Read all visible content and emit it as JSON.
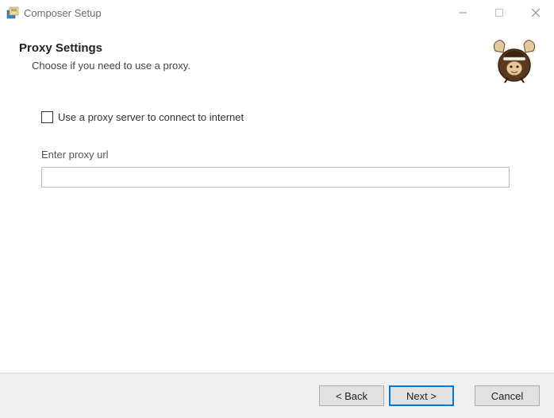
{
  "window": {
    "title": "Composer Setup"
  },
  "header": {
    "title": "Proxy Settings",
    "subtitle": "Choose if you need to use a proxy."
  },
  "content": {
    "checkbox_label": "Use a proxy server to connect to internet",
    "proxy_url_label": "Enter proxy url",
    "proxy_url_value": ""
  },
  "footer": {
    "back_label": "< Back",
    "next_label": "Next >",
    "cancel_label": "Cancel"
  }
}
